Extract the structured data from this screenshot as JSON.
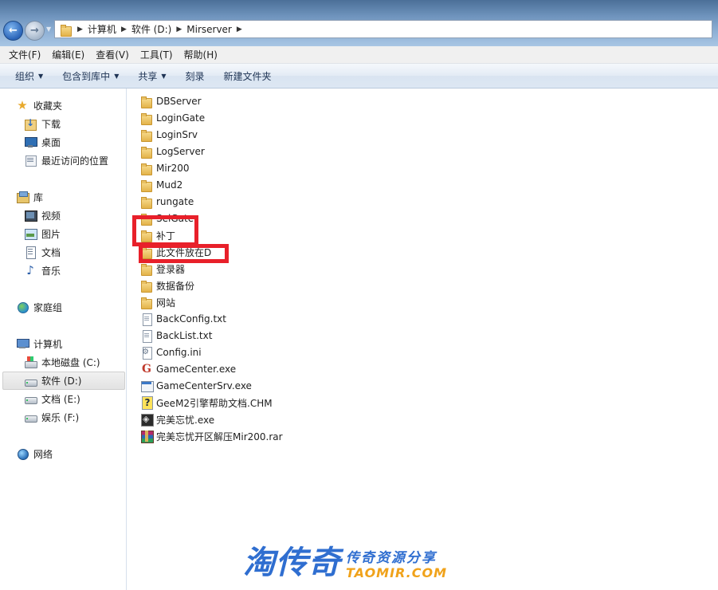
{
  "address": {
    "crumbs": [
      "计算机",
      "软件 (D:)",
      "Mirserver"
    ]
  },
  "menu": [
    "文件(F)",
    "编辑(E)",
    "查看(V)",
    "工具(T)",
    "帮助(H)"
  ],
  "toolbar": {
    "organize": "组织",
    "include_library": "包含到库中",
    "share": "共享",
    "burn": "刻录",
    "new_folder": "新建文件夹"
  },
  "nav": {
    "favorites": "收藏夹",
    "downloads": "下载",
    "desktop": "桌面",
    "recent": "最近访问的位置",
    "libraries": "库",
    "videos": "视频",
    "pictures": "图片",
    "documents": "文档",
    "music": "音乐",
    "homegroup": "家庭组",
    "computer": "计算机",
    "drive_c": "本地磁盘 (C:)",
    "drive_d": "软件 (D:)",
    "drive_e": "文档 (E:)",
    "drive_f": "娱乐 (F:)",
    "network": "网络"
  },
  "files": [
    {
      "name": "DBServer",
      "icon": "folder"
    },
    {
      "name": "LoginGate",
      "icon": "folder"
    },
    {
      "name": "LoginSrv",
      "icon": "folder"
    },
    {
      "name": "LogServer",
      "icon": "folder"
    },
    {
      "name": "Mir200",
      "icon": "folder"
    },
    {
      "name": "Mud2",
      "icon": "folder"
    },
    {
      "name": "rungate",
      "icon": "folder"
    },
    {
      "name": "SelGate",
      "icon": "folder"
    },
    {
      "name": "补丁",
      "icon": "folder"
    },
    {
      "name": "此文件放在D",
      "icon": "folder"
    },
    {
      "name": "登录器",
      "icon": "folder"
    },
    {
      "name": "数据备份",
      "icon": "folder"
    },
    {
      "name": "网站",
      "icon": "folder"
    },
    {
      "name": "BackConfig.txt",
      "icon": "text-file"
    },
    {
      "name": "BackList.txt",
      "icon": "text-file"
    },
    {
      "name": "Config.ini",
      "icon": "settings-file"
    },
    {
      "name": "GameCenter.exe",
      "icon": "g-app"
    },
    {
      "name": "GameCenterSrv.exe",
      "icon": "window-app"
    },
    {
      "name": "GeeM2引擎帮助文档.CHM",
      "icon": "help-file"
    },
    {
      "name": "完美忘忧.exe",
      "icon": "dark-app"
    },
    {
      "name": "完美忘忧开区解压Mir200.rar",
      "icon": "rar-archive"
    }
  ],
  "watermark": {
    "main": "淘传奇",
    "tagline": "传奇资源分享",
    "site": "TAOMIR.COM"
  },
  "colors": {
    "highlight": "#e8202a",
    "watermark_blue": "#2f6ed0",
    "watermark_orange": "#f0a21a"
  }
}
